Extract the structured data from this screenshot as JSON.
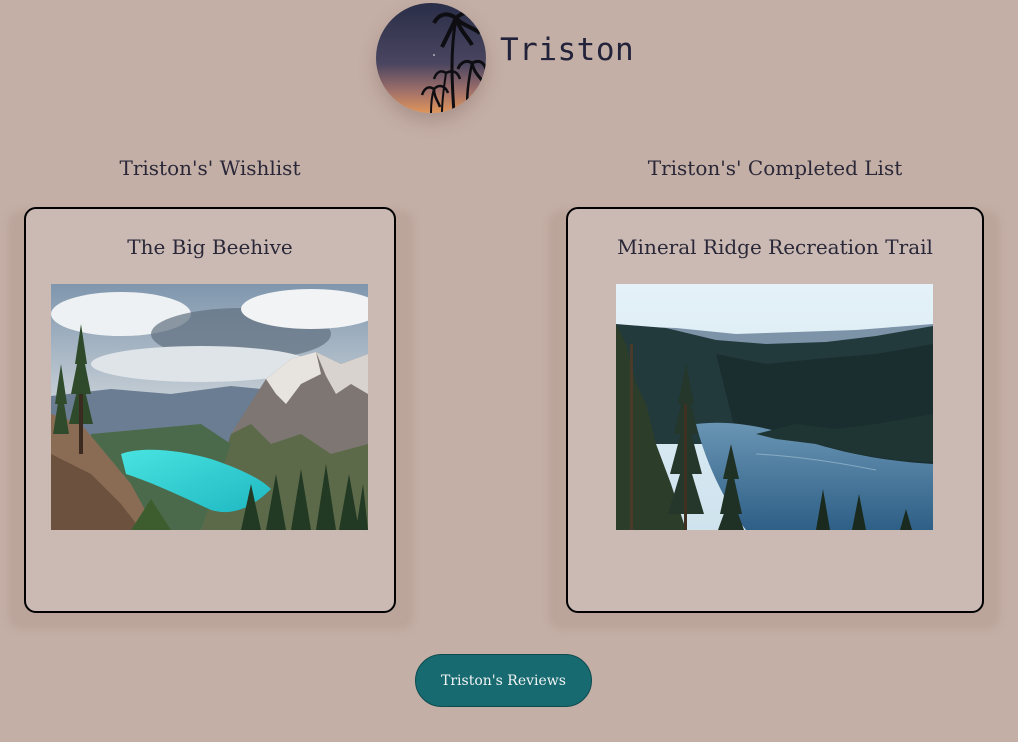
{
  "profile": {
    "name": "Triston",
    "avatar_icon": "sunset-palm-trees-photo"
  },
  "wishlist": {
    "heading": "Triston's' Wishlist",
    "item_title": "The Big Beehive",
    "photo_icon": "turquoise-mountain-lake-photo"
  },
  "completed": {
    "heading": "Triston's' Completed List",
    "item_title": "Mineral Ridge Recreation Trail",
    "photo_icon": "forest-lake-valley-photo"
  },
  "reviews_button": {
    "label": "Triston's Reviews"
  },
  "colors": {
    "background": "#c4afa6",
    "card": "#cbbab4",
    "button": "#166a70",
    "text": "#22223a"
  }
}
